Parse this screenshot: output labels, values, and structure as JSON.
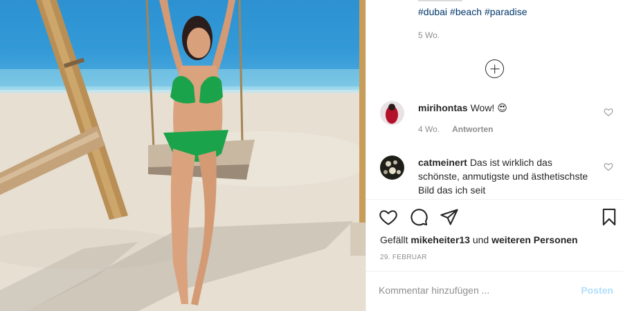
{
  "post": {
    "hashtags": [
      "#dubai",
      "#beach",
      "#paradise"
    ],
    "caption_age": "5 Wo.",
    "load_more_icon": "plus-circle-icon"
  },
  "comments": [
    {
      "username": "mirihontas",
      "text": "Wow! 😍",
      "age": "4 Wo.",
      "reply_label": "Antworten"
    },
    {
      "username": "catmeinert",
      "text": "Das ist wirklich das schönste, anmutigste und ästhetischste Bild das ich seit"
    }
  ],
  "actions": {
    "icons": [
      "heart-icon",
      "comment-bubble-icon",
      "paper-plane-icon",
      "bookmark-icon"
    ]
  },
  "likes": {
    "prefix": "Gefällt",
    "user": "mikeheiter13",
    "middle": "und",
    "others": "weiteren Personen"
  },
  "date": "29. FEBRUAR",
  "comment_box": {
    "placeholder": "Kommentar hinzufügen ...",
    "post_label": "Posten"
  },
  "colors": {
    "link": "#00376b",
    "muted": "#8e8e8e",
    "post_disabled": "#b2dffc",
    "bikini": "#1aa34a"
  }
}
